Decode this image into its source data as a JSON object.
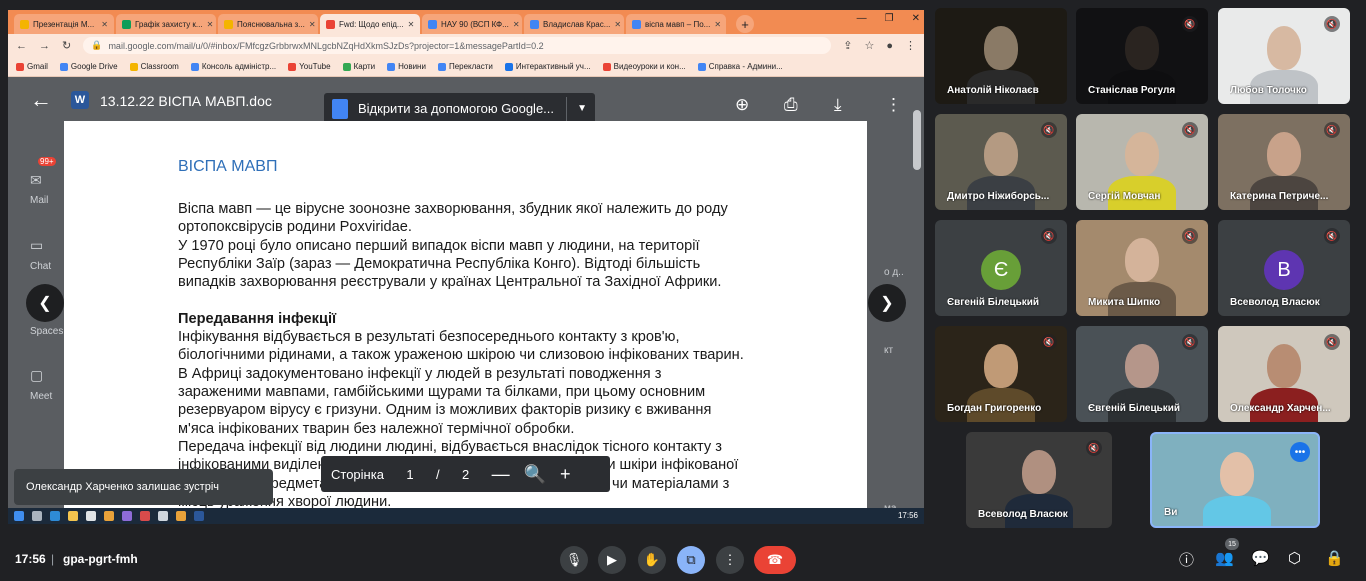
{
  "browser": {
    "tabs": [
      {
        "label": "Презентація М...",
        "color": "#f4b400"
      },
      {
        "label": "Графік захисту к...",
        "color": "#0f9d58"
      },
      {
        "label": "Пояснювальна з...",
        "color": "#f4b400"
      },
      {
        "label": "Fwd: Щодо епід...",
        "color": "#ea4335"
      },
      {
        "label": "НАУ 90 (ВСП КФ...",
        "color": "#4285f4"
      },
      {
        "label": "Владислав Крас...",
        "color": "#4285f4"
      },
      {
        "label": "віспа мавп – По...",
        "color": "#4285f4"
      }
    ],
    "url": "mail.google.com/mail/u/0/#inbox/FMfcgzGrbbrwxMNLgcbNZqHdXkmSJzDs?projector=1&messagePartId=0.2",
    "bookmarks": [
      "Gmail",
      "Google Drive",
      "Classroom",
      "Консоль адміністр...",
      "YouTube",
      "Карти",
      "Новини",
      "Перекласти",
      "Интерактивный уч...",
      "Видеоуроки и кон...",
      "Справка - Админи..."
    ]
  },
  "gmail_sidebar": {
    "badge": "99+",
    "items": [
      "Mail",
      "Chat",
      "Spaces",
      "Meet"
    ]
  },
  "viewer": {
    "doc_name": "13.12.22 ВІСПА МАВП.doc",
    "open_with": "Відкрити за допомогою Google...",
    "page_label": "Сторінка",
    "page_current": "1",
    "page_sep": "/",
    "page_total": "2",
    "zoom_out": "—",
    "zoom_in": "+"
  },
  "document": {
    "title": "ВІСПА МАВП",
    "lines_intro": [
      "Віспа мавп — це вірусне зоонозне захворювання, збудник якої належить до роду",
      "ортопоксвірусів родини Poxviridae.",
      "У 1970 році було описано перший випадок віспи мавп у людини, на території",
      "Республіки Заїр (зараз — Демократична Республіка Конго). Відтоді більшість",
      "випадків захворювання реєстрували у країнах Центральної та Західної Африки."
    ],
    "section_heading": "Передавання інфекції",
    "lines_transmission": [
      "Інфікування   відбувається в результаті безпосереднього контакту з кров'ю,",
      "біологічними рідинами, а також ураженою шкірою чи слизовою інфікованих тварин.",
      "В Африці задокументовано інфекції у людей в результаті поводження з",
      "зараженими мавпами, гамбійськими щурами та білками, при цьому основним",
      "резервуаром вірусу є гризуни. Одним із можливих факторів ризику є вживання",
      "м'яса інфікованих тварин без належної термічної обробки.",
      " Передача інфекції від людини людині, відбувається внаслідок тісного контакту з",
      "інфікованими виділеннями з дихальних шляхів, пошкодженнями шкіри інфікованої",
      "людини або предметами, забрудненими біологічними рідинами чи матеріалами з",
      "місць ураження хворої людини."
    ]
  },
  "notification": "Олександр Харченко залишає зустріч",
  "taskbar_time": "17:56",
  "participants": [
    {
      "name": "Анатолій Ніколаєв",
      "muted": false,
      "bg": "#1d1a14",
      "skin": "#8a7a66",
      "shirt": "#2a2a2a"
    },
    {
      "name": "Станіслав Рогуля",
      "muted": true,
      "bg": "#111113",
      "skin": "#2a2420",
      "shirt": "#0e0e10"
    },
    {
      "name": "Любов Толочко",
      "muted": true,
      "bg": "#e9eaea",
      "skin": "#d7b9a2",
      "shirt": "#bfc3c7"
    },
    {
      "name": "Дмитро Ніжиборсь...",
      "muted": true,
      "bg": "#5c5a4f",
      "skin": "#b49a82",
      "shirt": "#3b3f44"
    },
    {
      "name": "Сергій Мовчан",
      "muted": true,
      "bg": "#b8b7ae",
      "skin": "#d5b59a",
      "shirt": "#d8cf2b"
    },
    {
      "name": "Катерина Петриче...",
      "muted": true,
      "bg": "#7d7061",
      "skin": "#c8a28a",
      "shirt": "#4c4540"
    },
    {
      "name": "Євгеній Білецький",
      "muted": true,
      "avatar": "Є",
      "avatar_color": "#689f38"
    },
    {
      "name": "Микита Шипко",
      "muted": true,
      "bg": "#a48a6d",
      "skin": "#d4b39a",
      "shirt": "#6b5a48"
    },
    {
      "name": "Всеволод Власюк",
      "muted": true,
      "avatar": "В",
      "avatar_color": "#5e35b1"
    },
    {
      "name": "Богдан Григоренко",
      "muted": true,
      "bg": "#2b2419",
      "skin": "#c09a76",
      "shirt": "#5e4a2a"
    },
    {
      "name": "Євгеній Білецький",
      "muted": true,
      "bg": "#4a5156",
      "skin": "#b5968a",
      "shirt": "#2c3033"
    },
    {
      "name": "Олександр Харчен...",
      "muted": true,
      "bg": "#cfc8bd",
      "skin": "#b88d73",
      "shirt": "#8b1f1f"
    },
    {
      "name": "Всеволод Власюк",
      "muted": true,
      "bg": "#3a3a3a",
      "skin": "#b09080",
      "shirt": "#1f2a3a"
    },
    {
      "name": "Ви",
      "muted": false,
      "bg": "#7fb0bf",
      "skin": "#e3c0a8",
      "shirt": "#63c7e6"
    }
  ],
  "meeting": {
    "time": "17:56",
    "separator": "|",
    "code": "gpa-pgrt-fmh",
    "people_count": "15"
  }
}
